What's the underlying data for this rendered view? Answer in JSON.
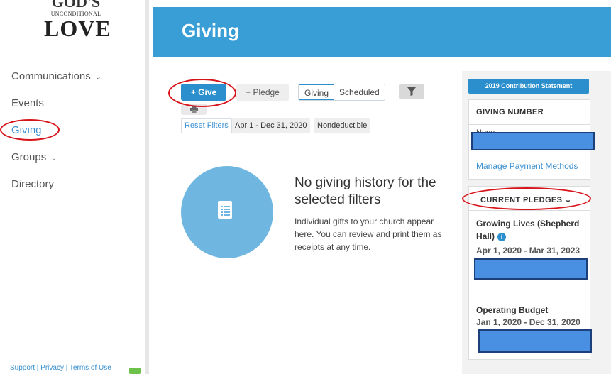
{
  "logo": {
    "top": "GOD'S",
    "mid": "UNCONDITIONAL",
    "bottom": "LOVE"
  },
  "sidebar": {
    "items": [
      {
        "label": "Communications",
        "has_chevron": true
      },
      {
        "label": "Events",
        "has_chevron": false
      },
      {
        "label": "Giving",
        "has_chevron": false,
        "active": true
      },
      {
        "label": "Groups",
        "has_chevron": true
      },
      {
        "label": "Directory",
        "has_chevron": false
      }
    ],
    "chevron": "⌄",
    "footer": "Support | Privacy | Terms of Use"
  },
  "header": {
    "title": "Giving"
  },
  "toolbar": {
    "give_label": "+ Give",
    "pledge_label": "+ Pledge",
    "tab_giving": "Giving",
    "tab_scheduled": "Scheduled",
    "filter_icon": "filter-icon",
    "print_icon": "print-icon"
  },
  "filters": {
    "reset": "Reset Filters",
    "date_range": "Apr 1 - Dec 31, 2020",
    "type": "Nondeductible"
  },
  "empty_state": {
    "title": "No giving history for the selected filters",
    "description": "Individual gifts to your church appear here. You can review and print them as receipts at any time.",
    "icon": "document-icon"
  },
  "right": {
    "statement_button": "2019 Contribution Statement",
    "giving_number": {
      "heading": "GIVING NUMBER",
      "value": "None",
      "manage_link": "Manage Payment Methods"
    },
    "pledges": {
      "heading": "CURRENT PLEDGES ⌄",
      "items": [
        {
          "name": "Growing Lives (Shepherd Hall)",
          "dates": "Apr 1, 2020 - Mar 31, 2023"
        },
        {
          "name": "Operating Budget",
          "dates": "Jan 1, 2020 - Dec 31, 2020"
        }
      ]
    }
  },
  "colors": {
    "header_blue": "#3a9ed6",
    "button_blue": "#2a8fcc",
    "annotation_red": "#d8141b",
    "redaction_fill": "#4a90e2"
  }
}
